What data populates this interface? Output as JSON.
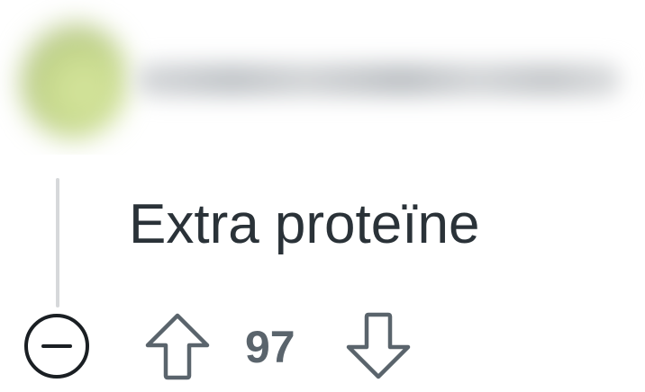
{
  "comment": {
    "body": "Extra proteïne",
    "vote_count": "97",
    "icons": {
      "collapse": "collapse-minus-circle-icon",
      "upvote": "arrow-up-outline-icon",
      "downvote": "arrow-down-outline-icon"
    },
    "colors": {
      "text": "#2a3238",
      "icon": "#5a646c",
      "thread_line": "#d6d8da"
    }
  }
}
